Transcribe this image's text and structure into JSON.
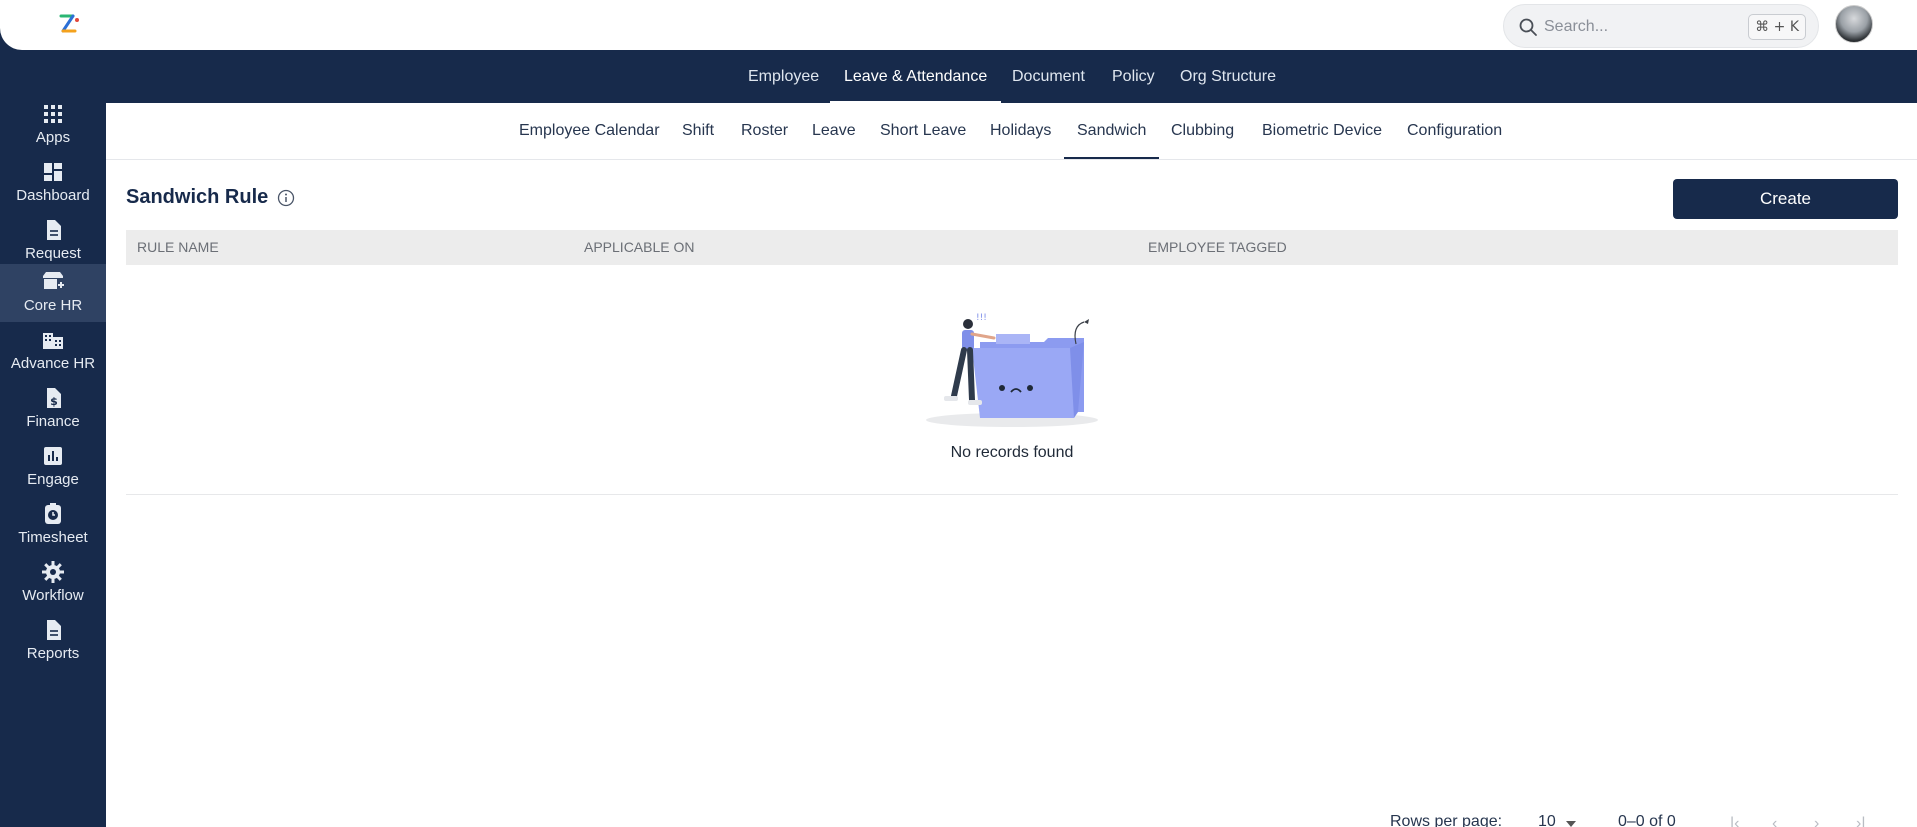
{
  "header": {
    "search": {
      "placeholder": "Search...",
      "shortcut": "⌘ + K"
    }
  },
  "sidebar": {
    "items": [
      {
        "label": "Apps",
        "icon": "apps-grid-icon"
      },
      {
        "label": "Dashboard",
        "icon": "dashboard-icon"
      },
      {
        "label": "Request",
        "icon": "request-document-icon"
      },
      {
        "label": "Core HR",
        "icon": "core-hr-icon",
        "active": true
      },
      {
        "label": "Advance HR",
        "icon": "building-icon"
      },
      {
        "label": "Finance",
        "icon": "finance-dollar-icon"
      },
      {
        "label": "Engage",
        "icon": "engage-chart-icon"
      },
      {
        "label": "Timesheet",
        "icon": "timesheet-clock-icon"
      },
      {
        "label": "Workflow",
        "icon": "workflow-gear-icon"
      },
      {
        "label": "Reports",
        "icon": "reports-document-icon"
      }
    ]
  },
  "module_nav": {
    "tabs": [
      {
        "label": "Employee"
      },
      {
        "label": "Leave & Attendance",
        "active": true
      },
      {
        "label": "Document"
      },
      {
        "label": "Policy"
      },
      {
        "label": "Org Structure"
      }
    ]
  },
  "sub_nav": {
    "tabs": [
      {
        "label": "Employee Calendar"
      },
      {
        "label": "Shift"
      },
      {
        "label": "Roster"
      },
      {
        "label": "Leave"
      },
      {
        "label": "Short Leave"
      },
      {
        "label": "Holidays"
      },
      {
        "label": "Sandwich",
        "active": true
      },
      {
        "label": "Clubbing"
      },
      {
        "label": "Biometric Device"
      },
      {
        "label": "Configuration"
      }
    ]
  },
  "page": {
    "title": "Sandwich Rule",
    "create_label": "Create"
  },
  "table": {
    "columns": [
      "RULE NAME",
      "APPLICABLE ON",
      "EMPLOYEE TAGGED"
    ],
    "rows": [],
    "empty_text": "No records found"
  },
  "pagination": {
    "rows_per_page_label": "Rows per page:",
    "rows_per_page_value": "10",
    "range": "0–0 of 0"
  },
  "colors": {
    "primary": "#172a4b",
    "active_sidebar": "#2f4263",
    "illustration": "#9aa8f5"
  }
}
